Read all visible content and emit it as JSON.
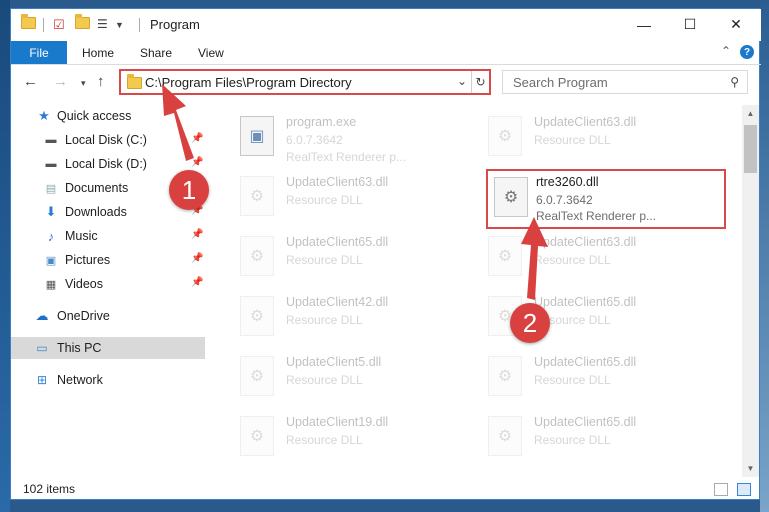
{
  "window": {
    "title": "Program",
    "controls": {
      "minimize": "—",
      "maximize": "☐",
      "close": "✕"
    }
  },
  "ribbon": {
    "file_tab": "File",
    "tabs": [
      "Home",
      "Share",
      "View"
    ]
  },
  "address": {
    "path": "C:\\Program Files\\Program Directory"
  },
  "search": {
    "placeholder": "Search Program"
  },
  "sidebar": {
    "items": [
      {
        "label": "Quick access",
        "icon": "star-icon"
      },
      {
        "label": "Local Disk (C:)",
        "icon": "drive-icon",
        "pinned": true
      },
      {
        "label": "Local Disk (D:)",
        "icon": "drive-icon",
        "pinned": true
      },
      {
        "label": "Documents",
        "icon": "document-icon",
        "pinned": true
      },
      {
        "label": "Downloads",
        "icon": "download-icon",
        "pinned": true
      },
      {
        "label": "Music",
        "icon": "music-icon",
        "pinned": true
      },
      {
        "label": "Pictures",
        "icon": "pictures-icon",
        "pinned": true
      },
      {
        "label": "Videos",
        "icon": "videos-icon",
        "pinned": true
      },
      {
        "label": "OneDrive",
        "icon": "cloud-icon"
      },
      {
        "label": "This PC",
        "icon": "computer-icon",
        "selected": true
      },
      {
        "label": "Network",
        "icon": "network-icon"
      }
    ]
  },
  "files": {
    "left": [
      {
        "name": "program.exe",
        "line2": "6.0.7.3642",
        "line3": "RealText Renderer p..."
      },
      {
        "name": "UpdateClient63.dll",
        "line2": "Resource DLL"
      },
      {
        "name": "UpdateClient65.dll",
        "line2": "Resource DLL"
      },
      {
        "name": "UpdateClient42.dll",
        "line2": "Resource DLL"
      },
      {
        "name": "UpdateClient5.dll",
        "line2": "Resource DLL"
      },
      {
        "name": "UpdateClient19.dll",
        "line2": "Resource DLL"
      }
    ],
    "right": [
      {
        "name": "UpdateClient63.dll",
        "line2": "Resource DLL"
      },
      {
        "name": "rtre3260.dll",
        "line2": "6.0.7.3642",
        "line3": "RealText Renderer p...",
        "highlighted": true
      },
      {
        "name": "UpdateClient63.dll",
        "line2": "Resource DLL"
      },
      {
        "name": "UpdateClient65.dll",
        "line2": "Resource DLL"
      },
      {
        "name": "UpdateClient65.dll",
        "line2": "Resource DLL"
      },
      {
        "name": "UpdateClient65.dll",
        "line2": "Resource DLL"
      }
    ]
  },
  "status": {
    "item_count": "102 items"
  },
  "callouts": {
    "step1": "1",
    "step2": "2",
    "color": "#d94040"
  }
}
